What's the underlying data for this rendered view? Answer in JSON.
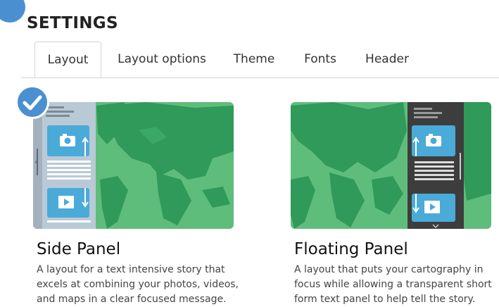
{
  "header": {
    "title": "SETTINGS"
  },
  "tabs": [
    {
      "label": "Layout",
      "active": true
    },
    {
      "label": "Layout options",
      "active": false
    },
    {
      "label": "Theme",
      "active": false
    },
    {
      "label": "Fonts",
      "active": false
    },
    {
      "label": "Header",
      "active": false
    }
  ],
  "layouts": [
    {
      "title": "Side Panel",
      "description": "A layout for a text intensive story that excels at combining your photos, videos, and maps in a clear focused message.",
      "selected": true
    },
    {
      "title": "Floating Panel",
      "description": "A layout that puts your cartography in focus while allowing a transparent short form text panel to help tell the story.",
      "selected": false
    }
  ],
  "colors": {
    "accent": "#4a90d0",
    "map_ocean": "#5fbd7c",
    "map_land": "#2f9a5a",
    "side_panel": "#b9c9d6",
    "floating_panel": "#3d3d3d",
    "media_block": "#4aaad8"
  },
  "icons": [
    "check-icon",
    "camera-icon",
    "video-icon",
    "arrow-up-icon",
    "arrow-down-icon",
    "resize-handle-icon",
    "chevron-down-icon"
  ]
}
